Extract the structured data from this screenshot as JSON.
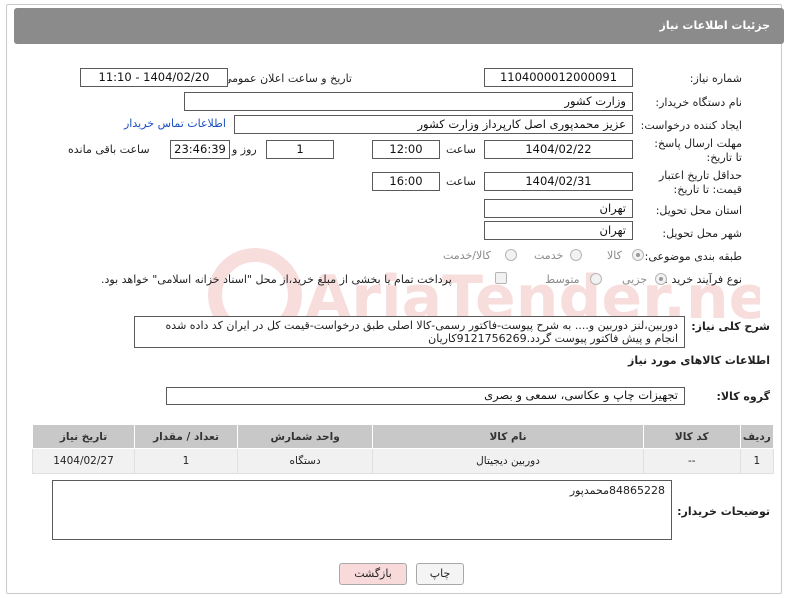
{
  "header": {
    "title": "جزئیات اطلاعات نیاز"
  },
  "need_number": {
    "label": "شماره نیاز:",
    "value": "1104000012000091"
  },
  "announce": {
    "label": "تاریخ و ساعت اعلان عمومی:",
    "value": "1404/02/20 - 11:10"
  },
  "buyer_org": {
    "label": "نام دستگاه خریدار:",
    "value": "وزارت کشور"
  },
  "requester": {
    "label": "ایجاد کننده درخواست:",
    "value": "عزیز محمدپوری اصل کارپرداز وزارت کشور",
    "contact_link": "اطلاعات تماس خریدار"
  },
  "reply_deadline": {
    "label": "مهلت ارسال پاسخ: تا تاریخ:",
    "date": "1404/02/22",
    "time_label": "ساعت",
    "time": "12:00",
    "days": "1",
    "days_label": "روز و",
    "remaining": "23:46:39",
    "remaining_label": "ساعت باقی مانده"
  },
  "price_validity": {
    "label": "حداقل تاریخ اعتبار قیمت: تا تاریخ:",
    "date": "1404/02/31",
    "time_label": "ساعت",
    "time": "16:00"
  },
  "delivery_province": {
    "label": "استان محل تحویل:",
    "value": "تهران"
  },
  "delivery_city": {
    "label": "شهر محل تحویل:",
    "value": "تهران"
  },
  "category": {
    "label": "طبقه بندی موضوعی:",
    "options": [
      "کالا",
      "خدمت",
      "کالا/خدمت"
    ],
    "selected": "کالا"
  },
  "purchase_type": {
    "label": "نوع فرآیند خرید :",
    "options": [
      "جزیی",
      "متوسط"
    ],
    "selected": "جزیی",
    "payment_note": "پرداخت تمام یا بخشی از مبلغ خرید،از محل \"اسناد خزانه اسلامی\" خواهد بود."
  },
  "general_desc": {
    "label": "شرح کلی نیاز:",
    "value": "دوربین،لنز دوربین و.... به شرح پیوست-فاکتور رسمی-کالا اصلی طبق درخواست-قیمت کل در ایران کد داده شده انجام و پیش فاکتور پیوست گردد.9121756269کاریان"
  },
  "goods_info": {
    "title": "اطلاعات کالاهای مورد نیاز"
  },
  "goods_group": {
    "label": "گروه کالا:",
    "value": "تجهیزات چاپ و عکاسی، سمعی و بصری"
  },
  "table": {
    "headers": [
      "ردیف",
      "کد کالا",
      "نام کالا",
      "واحد شمارش",
      "تعداد / مقدار",
      "تاریخ نیاز"
    ],
    "rows": [
      [
        "1",
        "--",
        "دوربین دیجیتال",
        "دستگاه",
        "1",
        "1404/02/27"
      ]
    ]
  },
  "buyer_notes": {
    "label": "توضیحات خریدار:",
    "value": "84865228محمدپور"
  },
  "buttons": {
    "print": "چاپ",
    "back": "بازگشت"
  },
  "watermark": {
    "text": "AriaTender.neT"
  },
  "colors": {
    "header_bg": "#8b8b8b",
    "link": "#1a4fbf",
    "back_button_bg": "#f8dada",
    "table_header_bg": "#c8c8c8"
  }
}
